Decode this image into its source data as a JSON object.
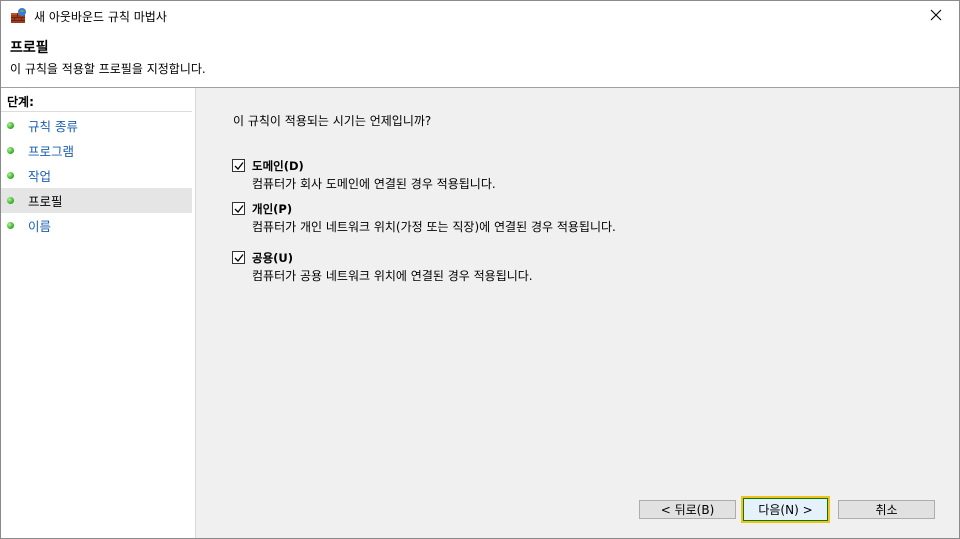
{
  "window": {
    "title": "새 아웃바운드 규칙 마법사",
    "close_glyph": "✕"
  },
  "header": {
    "title": "프로필",
    "description": "이 규칙을 적용할 프로필을 지정합니다."
  },
  "sidebar": {
    "heading": "단계:",
    "items": [
      {
        "label": "규칙 종류"
      },
      {
        "label": "프로그램"
      },
      {
        "label": "작업"
      },
      {
        "label": "프로필"
      },
      {
        "label": "이름"
      }
    ]
  },
  "main": {
    "question": "이 규칙이 적용되는 시기는 언제입니까?",
    "options": [
      {
        "title": "도메인(D)",
        "description": "컴퓨터가 회사 도메인에 연결된 경우 적용됩니다.",
        "checked": true
      },
      {
        "title": "개인(P)",
        "description": "컴퓨터가 개인 네트워크 위치(가정 또는 직장)에 연결된 경우 적용됩니다.",
        "checked": true
      },
      {
        "title": "공용(U)",
        "description": "컴퓨터가 공용 네트워크 위치에 연결된 경우 적용됩니다.",
        "checked": true
      }
    ]
  },
  "buttons": {
    "back": "< 뒤로(B)",
    "next": "다음(N) >",
    "cancel": "취소"
  },
  "colors": {
    "step_link": "#1a5fb4",
    "step_dot": "#3bb32a",
    "focus_border": "#f0c21c"
  }
}
